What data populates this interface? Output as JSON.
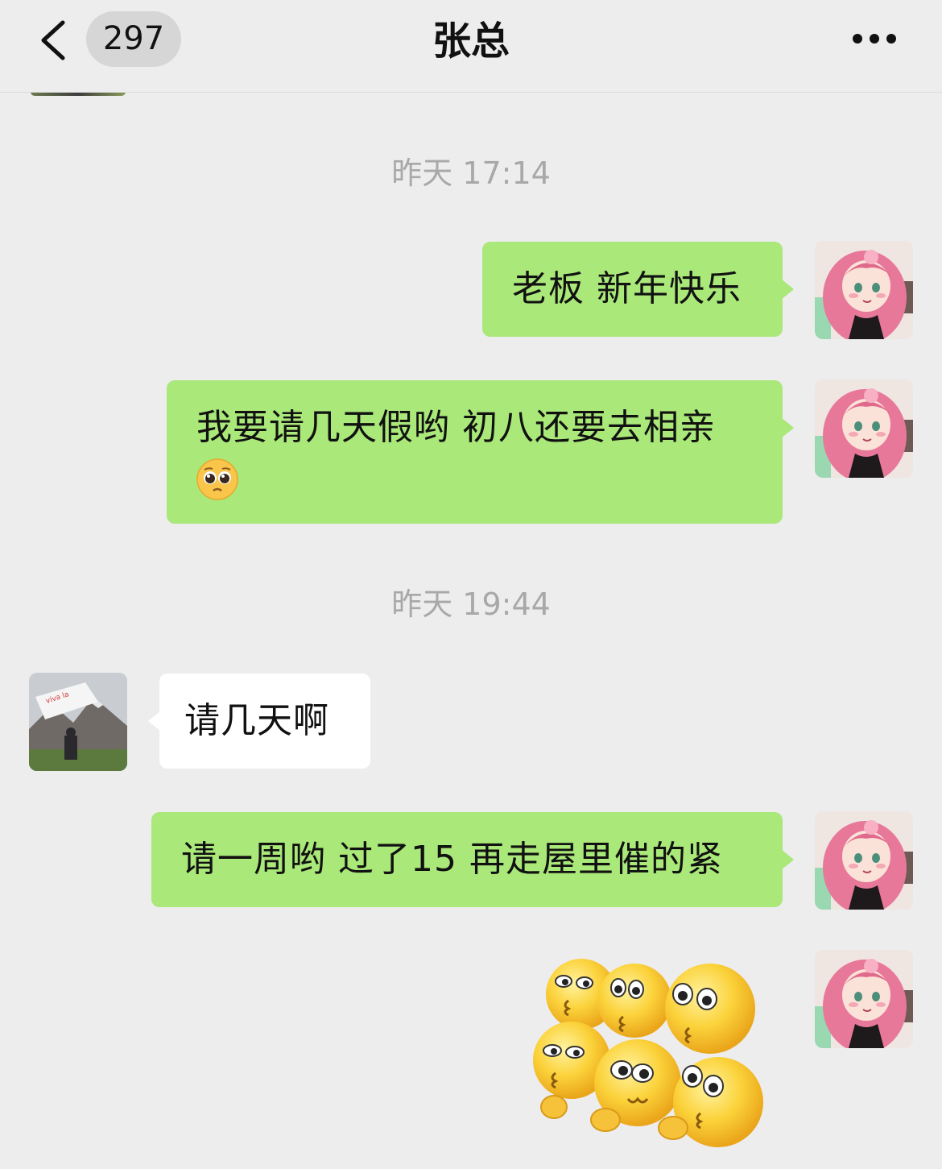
{
  "header": {
    "back_icon": "chevron-left-icon",
    "unread_count": "297",
    "title": "张总",
    "more_icon": "more-dots-icon"
  },
  "messages": [
    {
      "type": "time",
      "text": "昨天 17:14"
    },
    {
      "type": "text",
      "sender": "me",
      "text": "老板 新年快乐"
    },
    {
      "type": "text",
      "sender": "me",
      "text_line1": "我要请几天假哟 初八还要去相亲",
      "emoji": "pleading-face-emoji"
    },
    {
      "type": "time",
      "text": "昨天 19:44"
    },
    {
      "type": "text",
      "sender": "other",
      "text": "请几天啊"
    },
    {
      "type": "text",
      "sender": "me",
      "text": "请一周哟 过了15 再走屋里催的紧"
    },
    {
      "type": "sticker",
      "sender": "me",
      "sticker": "six-yellow-emoji-faces-sticker"
    }
  ],
  "avatars": {
    "me": "pink-hair-anime-girl-avatar",
    "other": "mountain-flag-photo-avatar"
  },
  "colors": {
    "background": "#ededed",
    "bubble_me": "#a9e879",
    "bubble_other": "#ffffff",
    "timestamp": "#a8a8a8"
  }
}
